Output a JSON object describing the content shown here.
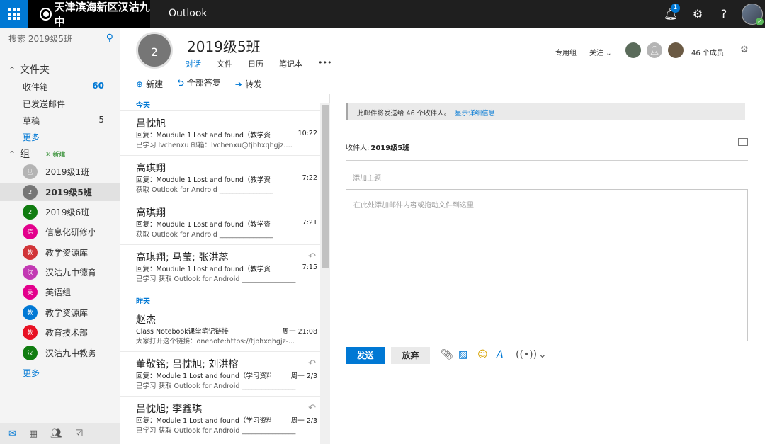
{
  "topbar": {
    "org_name": "天津滨海新区汉沽九中",
    "app_name": "Outlook",
    "notification_count": "1"
  },
  "leftnav": {
    "search_placeholder": "搜索 2019级5班",
    "folders_heading": "文件夹",
    "folders": [
      {
        "label": "收件箱",
        "count": "60"
      },
      {
        "label": "已发送邮件",
        "count": ""
      },
      {
        "label": "草稿",
        "count": "5"
      }
    ],
    "more_folders": "更多",
    "groups_heading": "组",
    "new_group": "✳ 新建",
    "groups": [
      {
        "label": "2019级1班",
        "avatar": "",
        "color": "#b4b4b4"
      },
      {
        "label": "2019级5班",
        "avatar": "2",
        "color": "#767676"
      },
      {
        "label": "2019级6班",
        "avatar": "2",
        "color": "#107c10"
      },
      {
        "label": "信息化研修小",
        "avatar": "信",
        "color": "#e3008c"
      },
      {
        "label": "教学资源库",
        "avatar": "教",
        "color": "#d13438"
      },
      {
        "label": "汉沽九中德育",
        "avatar": "汉",
        "color": "#c239b3"
      },
      {
        "label": "英语组",
        "avatar": "英",
        "color": "#e3008c"
      },
      {
        "label": "教学资源库",
        "avatar": "教",
        "color": "#0078d4"
      },
      {
        "label": "教育技术部",
        "avatar": "教",
        "color": "#e81123"
      },
      {
        "label": "汉沽九中教务",
        "avatar": "汉",
        "color": "#107c10"
      }
    ],
    "more_groups": "更多"
  },
  "group": {
    "avatar_text": "2",
    "title": "2019级5班",
    "tabs": [
      "对话",
      "文件",
      "日历",
      "笔记本",
      "•••"
    ],
    "private_label": "专用组",
    "follow_label": "关注",
    "members_label": "46 个成员"
  },
  "commands": {
    "new": "新建",
    "reply_all": "全部答复",
    "forward": "转发"
  },
  "messages": {
    "today_label": "今天",
    "yesterday_label": "昨天",
    "today": [
      {
        "from": "吕忱旭",
        "subject": "回复：Moudule 1 Lost and found（教学资料",
        "time": "10:22",
        "preview": "已学习 lvchenxu 邮箱：lvchenxu@tjbhxqhgjz.par...",
        "replied": false
      },
      {
        "from": "高琪翔",
        "subject": "回复：Moudule 1 Lost and found（教学资料",
        "time": "7:22",
        "preview": "获取 Outlook for Android ________________",
        "replied": false
      },
      {
        "from": "高琪翔",
        "subject": "回复：Moudule 1 Lost and found（教学资料",
        "time": "7:21",
        "preview": "获取 Outlook for Android ________________",
        "replied": false
      },
      {
        "from": "高琪翔; 马莹; 张洪蕊",
        "subject": "回复：Moudule 1 Lost and found（教学资料",
        "time": "7:15",
        "preview": "已学习 获取 Outlook for Android ________________",
        "replied": true
      }
    ],
    "yesterday": [
      {
        "from": "赵杰",
        "subject": "Class Notebook课堂笔记链接",
        "time": "周一 21:08",
        "preview": "大家打开这个链接：onenote:https://tjbhxqhgjz-...",
        "replied": false
      },
      {
        "from": "董敬铭; 吕忱旭; 刘洪榕",
        "subject": "回复：Module 1 Lost and found（学习资料",
        "time": "周一 2/3",
        "preview": "已学习 获取 Outlook for Android ________________",
        "replied": true
      },
      {
        "from": "吕忱旭; 李鑫琪",
        "subject": "回复：Module 1 Lost and found（学习资料）",
        "time": "周一 2/3",
        "preview": "已学习 获取 Outlook for Android ________________",
        "replied": true
      }
    ]
  },
  "compose": {
    "notice_text": "此邮件将发送给 46 个收件人。",
    "notice_link": "显示详细信息",
    "to_label": "收件人:",
    "to_value": "2019级5班",
    "subject_placeholder": "添加主题",
    "body_placeholder": "在此处添加邮件内容或拖动文件到这里",
    "send_label": "发送",
    "discard_label": "放弃"
  },
  "icons": {
    "bell": "bell-icon",
    "gear": "gear-icon",
    "help": "help-icon",
    "search": "search-icon",
    "attach": "paperclip-icon",
    "image": "image-icon",
    "emoji": "emoji-icon",
    "format": "format-text-icon",
    "signal": "broadcast-icon"
  },
  "colors": {
    "accent": "#0078d4",
    "topbar": "#1f1f1f"
  }
}
